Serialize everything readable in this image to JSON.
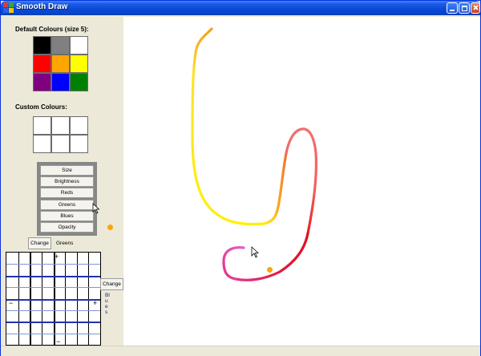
{
  "window": {
    "title": "Smooth Draw"
  },
  "colours": {
    "default_heading": "Default Colours (size 5):",
    "default": [
      "#000000",
      "#808080",
      "#FFFFFF",
      "#FF0000",
      "#FFA500",
      "#FFFF00",
      "#800080",
      "#0000FF",
      "#008000"
    ],
    "custom_heading": "Custom Colours:",
    "custom": [
      "#FFFFFF",
      "#FFFFFF",
      "#FFFFFF",
      "#FFFFFF",
      "#FFFFFF",
      "#FFFFFF"
    ]
  },
  "channels": [
    "Size",
    "Brightness",
    "Reds",
    "Greens",
    "Blues",
    "Opacity"
  ],
  "controls": {
    "change_top": "Change",
    "channel_top": "Greens",
    "change_right": "Change",
    "channel_right": "Blues"
  },
  "markers": {
    "plus": "+",
    "minus": "−"
  },
  "indicator_colour": "#FFA500"
}
